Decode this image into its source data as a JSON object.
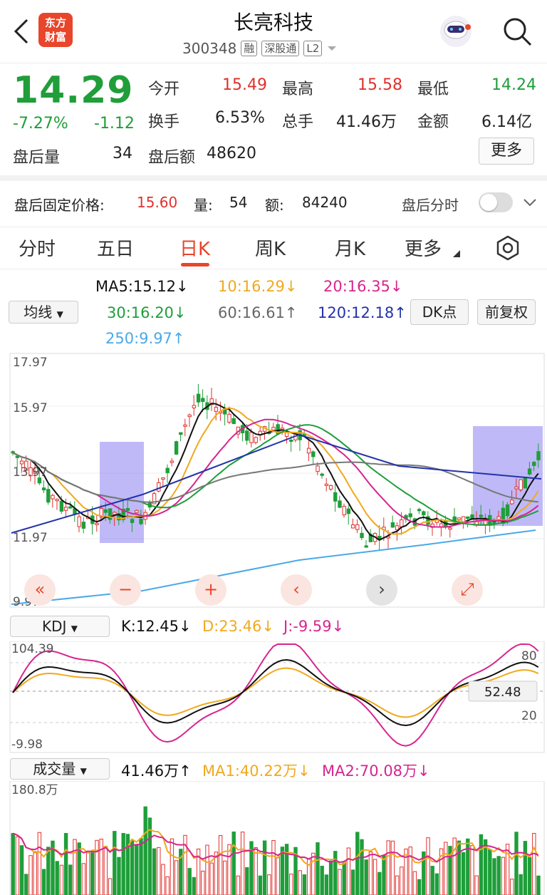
{
  "header": {
    "title": "长亮科技",
    "code": "300348",
    "tags": [
      "融",
      "深股通",
      "L2"
    ],
    "logo_text": "东方财富"
  },
  "quote": {
    "price": "14.29",
    "change_pct": "-7.27%",
    "change": "-1.12",
    "open_label": "今开",
    "open": "15.49",
    "high_label": "最高",
    "high": "15.58",
    "low_label": "最低",
    "low": "14.24",
    "turnover_label": "换手",
    "turnover": "6.53%",
    "volume_label": "总手",
    "volume": "41.46万",
    "amount_label": "金额",
    "amount": "6.14亿",
    "after_vol_label": "盘后量",
    "after_vol": "34",
    "after_amt_label": "盘后额",
    "after_amt": "48620",
    "more_label": "更多"
  },
  "after_hours": {
    "price_label": "盘后固定价格:",
    "price": "15.60",
    "qty_label": "量:",
    "qty": "54",
    "amt_label": "额:",
    "amt": "84240",
    "timeshare_label": "盘后分时"
  },
  "tabs": [
    "分时",
    "五日",
    "日K",
    "周K",
    "月K",
    "更多"
  ],
  "active_tab": "日K",
  "ma_legend": {
    "selector": "均线",
    "ma5": "MA5:15.12↓",
    "ma10": "10:16.29↓",
    "ma20": "20:16.35↓",
    "ma30": "30:16.20↓",
    "ma60": "60:16.61↑",
    "ma120": "120:12.18↑",
    "ma250": "250:9.97↑",
    "dk": "DK点",
    "adjust": "前复权"
  },
  "kline_axis": [
    "17.97",
    "15.97",
    "13.97",
    "11.97",
    "9.97"
  ],
  "kdj": {
    "selector": "KDJ",
    "k": "K:12.45↓",
    "d": "D:23.46↓",
    "j": "J:-9.59↓",
    "top": "104.39",
    "bottom": "-9.98",
    "current": "52.48",
    "level80": "80",
    "level20": "20"
  },
  "volume": {
    "selector": "成交量",
    "vol": "41.46万↑",
    "ma1": "MA1:40.22万↓",
    "ma2": "MA2:70.08万↓",
    "top": "180.8万"
  },
  "colors": {
    "up": "#e0312d",
    "down": "#1f9e3a",
    "accent": "#e8452b",
    "ma5": "#111111",
    "ma10": "#f0a91e",
    "ma20": "#d6258f",
    "ma30": "#1f9e3a",
    "ma60": "#777777",
    "ma120": "#2233aa",
    "ma250": "#4aa9e8"
  }
}
